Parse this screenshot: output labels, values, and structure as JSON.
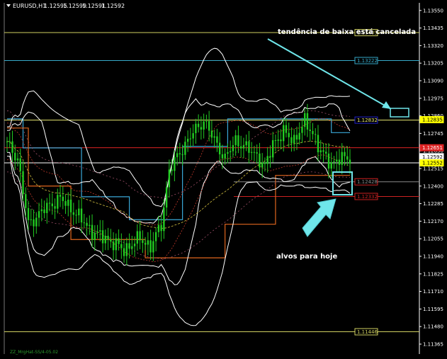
{
  "chart_data": {
    "type": "line",
    "symbol": "EURUSD,H1",
    "ohlc": [
      "1.12595",
      "1.12599",
      "1.12591",
      "1.12592"
    ],
    "ylim": [
      1.113,
      1.136
    ],
    "y_ticks": [
      "1.13550",
      "1.13435",
      "1.13320",
      "1.13205",
      "1.13090",
      "1.12975",
      "1.12860",
      "1.12745",
      "1.12630",
      "1.12515",
      "1.12400",
      "1.12285",
      "1.12170",
      "1.12055",
      "1.11940",
      "1.11825",
      "1.11710",
      "1.11595",
      "1.11480",
      "1.11365"
    ],
    "bars": 130,
    "price_path": [
      {
        "i": 0,
        "p": 1.1268
      },
      {
        "i": 4,
        "p": 1.1258
      },
      {
        "i": 8,
        "p": 1.1215
      },
      {
        "i": 14,
        "p": 1.1225
      },
      {
        "i": 20,
        "p": 1.1232
      },
      {
        "i": 26,
        "p": 1.1222
      },
      {
        "i": 32,
        "p": 1.121
      },
      {
        "i": 38,
        "p": 1.1205
      },
      {
        "i": 44,
        "p": 1.1198
      },
      {
        "i": 50,
        "p": 1.1206
      },
      {
        "i": 54,
        "p": 1.12
      },
      {
        "i": 58,
        "p": 1.1215
      },
      {
        "i": 61,
        "p": 1.125
      },
      {
        "i": 65,
        "p": 1.1262
      },
      {
        "i": 70,
        "p": 1.1275
      },
      {
        "i": 74,
        "p": 1.1283
      },
      {
        "i": 78,
        "p": 1.127
      },
      {
        "i": 82,
        "p": 1.1258
      },
      {
        "i": 86,
        "p": 1.127
      },
      {
        "i": 90,
        "p": 1.1265
      },
      {
        "i": 94,
        "p": 1.126
      },
      {
        "i": 97,
        "p": 1.1252
      },
      {
        "i": 100,
        "p": 1.1268
      },
      {
        "i": 104,
        "p": 1.1275
      },
      {
        "i": 108,
        "p": 1.127
      },
      {
        "i": 112,
        "p": 1.1282
      },
      {
        "i": 115,
        "p": 1.1275
      },
      {
        "i": 118,
        "p": 1.1262
      },
      {
        "i": 122,
        "p": 1.1255
      },
      {
        "i": 126,
        "p": 1.1258
      },
      {
        "i": 129,
        "p": 1.1259
      }
    ],
    "levels": [
      {
        "price": 1.13405,
        "label": "1.13405",
        "color": "#cfcf60",
        "box": "#cfcf60"
      },
      {
        "price": 1.13222,
        "label": "1.13222",
        "color": "#36a9c9",
        "box": "#36a9c9"
      },
      {
        "price": 1.12832,
        "label": "1.12832",
        "color": "#e8e870",
        "box": "#2222cc"
      },
      {
        "price": 1.12835,
        "label": "1.12835",
        "color": "#ffff00",
        "box": "#ffff00"
      },
      {
        "price": 1.12651,
        "label": "1.12651",
        "color": "#dd2222",
        "box": "#dd2222"
      },
      {
        "price": 1.12592,
        "label": "1.12592",
        "color": "#ffffff",
        "box": "#ffffff"
      },
      {
        "price": 1.12552,
        "label": "1.12552",
        "color": "#ffffff",
        "box": "#ffff00"
      },
      {
        "price": 1.12428,
        "label": "1.12428",
        "color": "#888888",
        "box": "#cc2222"
      },
      {
        "price": 1.12332,
        "label": "1.12332",
        "color": "#cc2222",
        "box": "#cc2222"
      },
      {
        "price": 1.11446,
        "label": "1.11446",
        "color": "#cfcf60",
        "box": "#cfcf60"
      }
    ],
    "annotations": {
      "top": "tendência de baixa está cancelada",
      "bottom": "alvos para hoje"
    },
    "footer": "ZZ_MrgHat-SS/4-05.02",
    "colors": {
      "candles": "#22cc22",
      "bands": "#ffffff",
      "channel_blue": "#3aa8d8",
      "channel_orange": "#e0661e",
      "arrow": "#6fe6ea"
    }
  }
}
